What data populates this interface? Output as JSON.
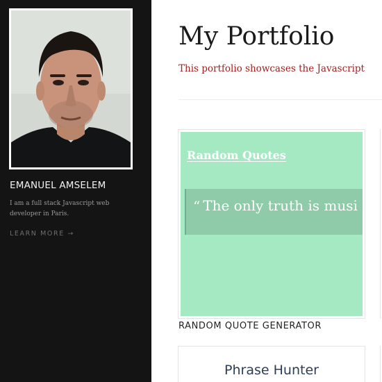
{
  "sidebar": {
    "name": "EMANUEL AMSELEM",
    "bio": "I am a full stack Javascript web developer in Paris.",
    "learn_more": "LEARN MORE →"
  },
  "main": {
    "title": "My Portfolio",
    "intro": "This portfolio showcases the Javascript",
    "projects": [
      {
        "preview_title": "Random Quotes",
        "quote_mark": "“",
        "quote_text": "The only truth is musi",
        "caption": "RANDOM QUOTE GENERATOR",
        "preview_color": "#a5e9c3"
      },
      {
        "preview_title": "Phrase Hunter"
      }
    ]
  },
  "colors": {
    "sidebar_bg": "#141414",
    "accent_red": "#a31f1f",
    "card_title": "#2c3e57"
  }
}
